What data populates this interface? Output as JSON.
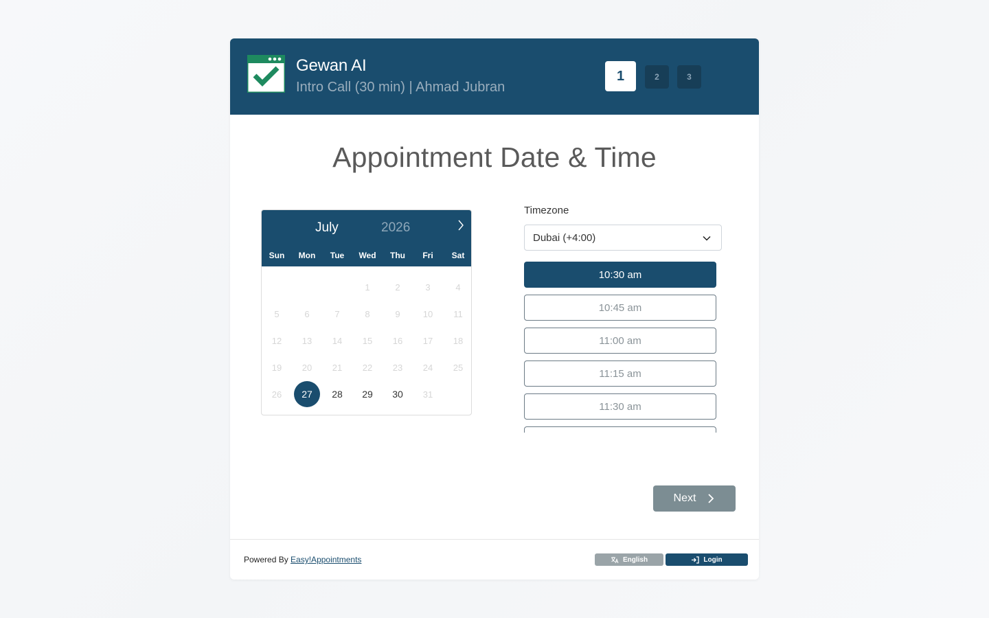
{
  "header": {
    "company_name": "Gewan AI",
    "service_line": "Intro Call (30 min) | Ahmad Jubran",
    "steps": [
      "1",
      "2",
      "3"
    ],
    "active_step": 1
  },
  "page_title": "Appointment Date & Time",
  "calendar": {
    "month": "July",
    "year": "2026",
    "weekdays": [
      "Sun",
      "Mon",
      "Tue",
      "Wed",
      "Thu",
      "Fri",
      "Sat"
    ],
    "first_weekday_index": 3,
    "days_in_month": 31,
    "available_days": [
      27,
      28,
      29,
      30
    ],
    "selected_day": 27
  },
  "timezone": {
    "label": "Timezone",
    "value": "Dubai (+4:00)"
  },
  "time_slots": [
    "10:30 am",
    "10:45 am",
    "11:00 am",
    "11:15 am",
    "11:30 am",
    ""
  ],
  "selected_slot_index": 0,
  "next_label": "Next",
  "footer": {
    "powered_by": "Powered By",
    "powered_link": "Easy!Appointments",
    "language_label": "English",
    "login_label": "Login"
  },
  "colors": {
    "primary": "#1a4d6e",
    "logo_green": "#1e8a5f",
    "next_button": "#7c8d93"
  },
  "icons": [
    "calendar-check-logo",
    "chevron-right-icon",
    "chevron-down-icon",
    "translate-icon",
    "sign-in-icon"
  ]
}
